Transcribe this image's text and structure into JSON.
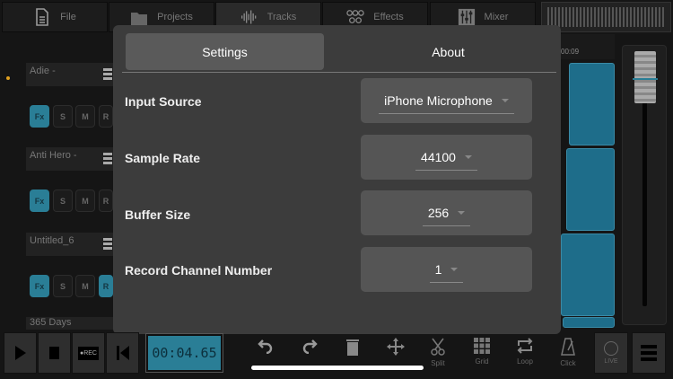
{
  "top_tabs": [
    {
      "label": "File",
      "icon": "file-icon"
    },
    {
      "label": "Projects",
      "icon": "folder-icon"
    },
    {
      "label": "Tracks",
      "icon": "waveform-icon"
    },
    {
      "label": "Effects",
      "icon": "effects-icon"
    },
    {
      "label": "Mixer",
      "icon": "mixer-icon"
    }
  ],
  "tracks": [
    {
      "name": "Adie -"
    },
    {
      "name": "Anti Hero -"
    },
    {
      "name": "Untitled_6"
    },
    {
      "name": "365 Days"
    }
  ],
  "track_buttons": {
    "fx": "Fx",
    "solo": "S",
    "mute": "M",
    "record": "R"
  },
  "timeline": {
    "tick": "00:09"
  },
  "modal": {
    "tabs": [
      {
        "label": "Settings",
        "active": true
      },
      {
        "label": "About",
        "active": false
      }
    ],
    "rows": [
      {
        "label": "Input Source",
        "value": "iPhone Microphone"
      },
      {
        "label": "Sample Rate",
        "value": "44100"
      },
      {
        "label": "Buffer Size",
        "value": "256"
      },
      {
        "label": "Record Channel Number",
        "value": "1"
      }
    ]
  },
  "transport": {
    "rec_label": "●REC",
    "time": "00:04.65"
  },
  "tools": [
    {
      "label": "",
      "icon": "undo-icon"
    },
    {
      "label": "",
      "icon": "redo-icon"
    },
    {
      "label": "",
      "icon": "trash-icon"
    },
    {
      "label": "",
      "icon": "move-icon"
    },
    {
      "label": "Split",
      "icon": "scissors-icon"
    },
    {
      "label": "Grid",
      "icon": "grid-icon"
    },
    {
      "label": "Loop",
      "icon": "loop-icon"
    },
    {
      "label": "Click",
      "icon": "metronome-icon"
    }
  ],
  "live_label": "LIVE",
  "colors": {
    "accent": "#2a7e96",
    "bg": "#151515",
    "modal": "#3c3c3c"
  }
}
